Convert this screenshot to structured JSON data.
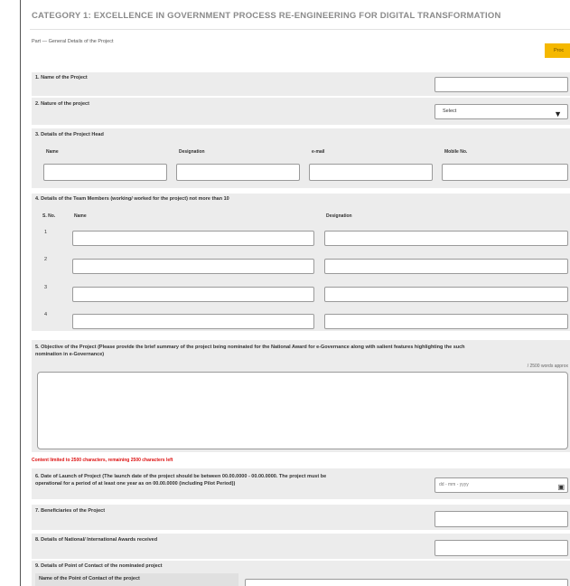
{
  "category_title": "CATEGORY 1: EXCELLENCE IN GOVERNMENT PROCESS RE-ENGINEERING FOR DIGITAL TRANSFORMATION",
  "part_label": "Part — General Details of the Project",
  "top_button_label": "Proc",
  "q1": {
    "label": "1. Name of the Project"
  },
  "q2": {
    "label": "2. Nature of the project",
    "select_value": "Select"
  },
  "q3": {
    "label": "3. Details of the Project Head",
    "headers": [
      "Name",
      "Designation",
      "e-mail",
      "Mobile No."
    ]
  },
  "q4": {
    "label": "4. Details of the Team Members (working/ worked for the project) not more than 10",
    "headers": {
      "sno": "S. No.",
      "name": "Name",
      "designation": "Designation"
    },
    "rows": [
      "1",
      "2",
      "3",
      "4"
    ]
  },
  "q5": {
    "label_line1": "5. Objective of the Project (Please provide the brief summary of the project being nominated for the National Award for e-Governance along with salient features highlighting the such",
    "label_line2": "nomination in e-Governance)",
    "counter": "/ 2500 words approx",
    "note": "Content limited to 2500 characters, remaining 2500 characters left"
  },
  "q6": {
    "label_line1": "6. Date of Launch of Project (The launch date of the project should be between 00.00.0000 - 00.00.0000. The project must be",
    "label_line2": "operational for a period of at least one year as on 00.00.0000 (including Pilot Period))",
    "date_placeholder": "dd - mm - yyyy"
  },
  "q7": {
    "label": "7. Beneficiaries of the Project"
  },
  "q8": {
    "label": "8. Details of National/ International Awards received"
  },
  "q9": {
    "label": "9. Details of Point of Contact of the nominated project",
    "sub_label": "Name of the Point of Contact of the project"
  }
}
